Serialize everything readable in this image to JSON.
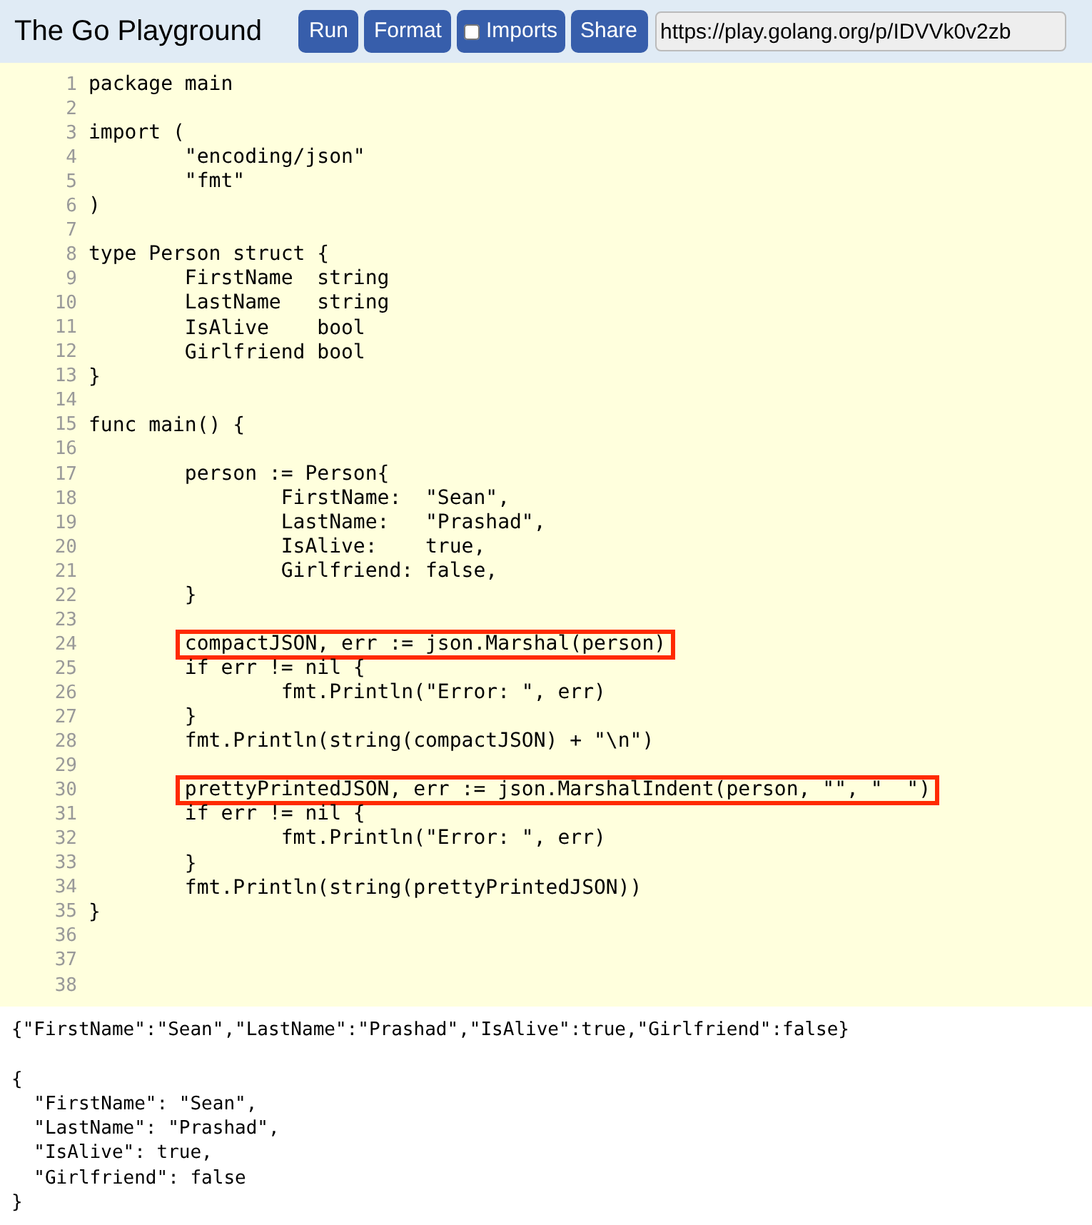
{
  "header": {
    "title": "The Go Playground",
    "buttons": [
      {
        "kind": "button",
        "label": "Run"
      },
      {
        "kind": "button",
        "label": "Format"
      },
      {
        "kind": "checkbox",
        "label": "Imports",
        "checked": false
      },
      {
        "kind": "button",
        "label": "Share"
      }
    ],
    "share_url": "https://play.golang.org/p/IDVVk0v2zb"
  },
  "editor": {
    "lines": [
      {
        "number": "1",
        "code": "package main",
        "highlighted": false
      },
      {
        "number": "2",
        "highlighted": false
      },
      {
        "number": "3",
        "code": "import (",
        "highlighted": false
      },
      {
        "number": "4",
        "code": "        \"encoding/json\"",
        "highlighted": false
      },
      {
        "number": "5",
        "code": "        \"fmt\"",
        "highlighted": false
      },
      {
        "number": "6",
        "code": ")",
        "highlighted": false
      },
      {
        "number": "7",
        "highlighted": false
      },
      {
        "number": "8",
        "code": "type Person struct {",
        "highlighted": false
      },
      {
        "number": "9",
        "code": "        FirstName  string",
        "highlighted": false
      },
      {
        "number": "10",
        "code": "        LastName   string",
        "highlighted": false
      },
      {
        "number": "11",
        "code": "        IsAlive    bool",
        "highlighted": false
      },
      {
        "number": "12",
        "code": "        Girlfriend bool",
        "highlighted": false
      },
      {
        "number": "13",
        "code": "}",
        "highlighted": false
      },
      {
        "number": "14",
        "highlighted": false
      },
      {
        "number": "15",
        "code": "func main() {",
        "highlighted": false
      },
      {
        "number": "16",
        "highlighted": false
      },
      {
        "number": "17",
        "code": "        person := Person{",
        "highlighted": false
      },
      {
        "number": "18",
        "code": "                FirstName:  \"Sean\",",
        "highlighted": false
      },
      {
        "number": "19",
        "code": "                LastName:   \"Prashad\",",
        "highlighted": false
      },
      {
        "number": "20",
        "code": "                IsAlive:    true,",
        "highlighted": false
      },
      {
        "number": "21",
        "code": "                Girlfriend: false,",
        "highlighted": false
      },
      {
        "number": "22",
        "code": "        }",
        "highlighted": false
      },
      {
        "number": "23",
        "highlighted": false
      },
      {
        "number": "24",
        "code": "        compactJSON, err := json.Marshal(person)",
        "highlighted": true
      },
      {
        "number": "25",
        "code": "        if err != nil {",
        "highlighted": false
      },
      {
        "number": "26",
        "code": "                fmt.Println(\"Error: \", err)",
        "highlighted": false
      },
      {
        "number": "27",
        "code": "        }",
        "highlighted": false
      },
      {
        "number": "28",
        "code": "        fmt.Println(string(compactJSON) + \"\\n\")",
        "highlighted": false
      },
      {
        "number": "29",
        "highlighted": false
      },
      {
        "number": "30",
        "code": "        prettyPrintedJSON, err := json.MarshalIndent(person, \"\", \"  \")",
        "highlighted": true
      },
      {
        "number": "31",
        "code": "        if err != nil {",
        "highlighted": false
      },
      {
        "number": "32",
        "code": "                fmt.Println(\"Error: \", err)",
        "highlighted": false
      },
      {
        "number": "33",
        "code": "        }",
        "highlighted": false
      },
      {
        "number": "34",
        "code": "        fmt.Println(string(prettyPrintedJSON))",
        "highlighted": false
      },
      {
        "number": "35",
        "code": "}",
        "highlighted": false
      },
      {
        "number": "36",
        "highlighted": false
      },
      {
        "number": "37",
        "highlighted": false
      },
      {
        "number": "38",
        "highlighted": false
      }
    ]
  },
  "output": {
    "compact_line": "{\"FirstName\":\"Sean\",\"LastName\":\"Prashad\",\"IsAlive\":true,\"Girlfriend\":false}",
    "pretty_lines": [
      "{",
      "  \"FirstName\": \"Sean\",",
      "  \"LastName\": \"Prashad\",",
      "  \"IsAlive\": true,",
      "  \"Girlfriend\": false",
      "}"
    ]
  }
}
